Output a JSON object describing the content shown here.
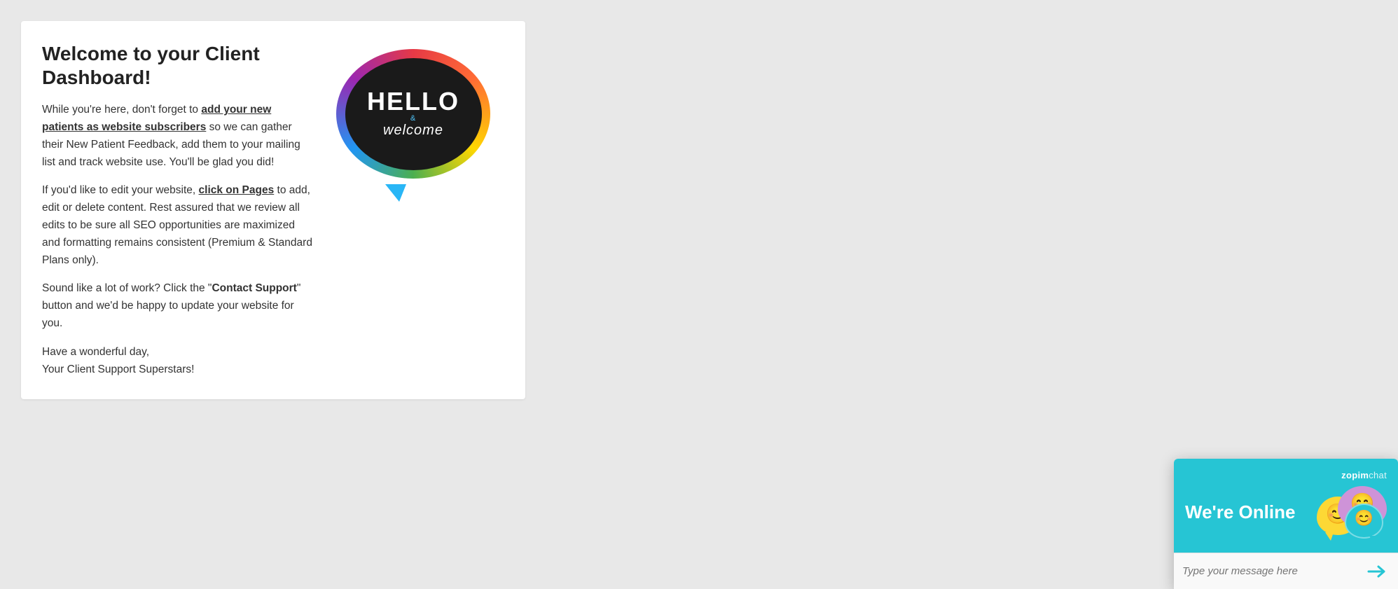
{
  "page": {
    "background_color": "#e8e8e8"
  },
  "welcome_card": {
    "title": "Welcome to your Client Dashboard!",
    "paragraph1_pre": "While you're here, don't forget to ",
    "paragraph1_link": "add your new patients as website subscribers",
    "paragraph1_post": " so we can gather their New Patient Feedback, add them to your mailing list and track website use. You'll be glad you did!",
    "paragraph2_pre": "If you'd like to edit your website, ",
    "paragraph2_link": "click on Pages",
    "paragraph2_post": " to add, edit or delete content. Rest assured that we review all edits to be sure all SEO opportunities are maximized and formatting remains consistent (Premium & Standard Plans only).",
    "paragraph3_pre": "Sound like a lot of work? Click the \"",
    "paragraph3_bold": "Contact Support",
    "paragraph3_post": "\" button and we'd be happy to update your website for you.",
    "paragraph4": "Have a wonderful day,",
    "paragraph5": "Your Client Support Superstars!",
    "image_alt": "Hello & Welcome speech bubble"
  },
  "image": {
    "hello": "HELLO",
    "ampersand": "&",
    "welcome": "welcome"
  },
  "chat": {
    "brand_zopim": "zopim",
    "brand_chat": "chat",
    "online_text": "We're Online",
    "input_placeholder": "Type your message here",
    "send_label": "Send"
  }
}
